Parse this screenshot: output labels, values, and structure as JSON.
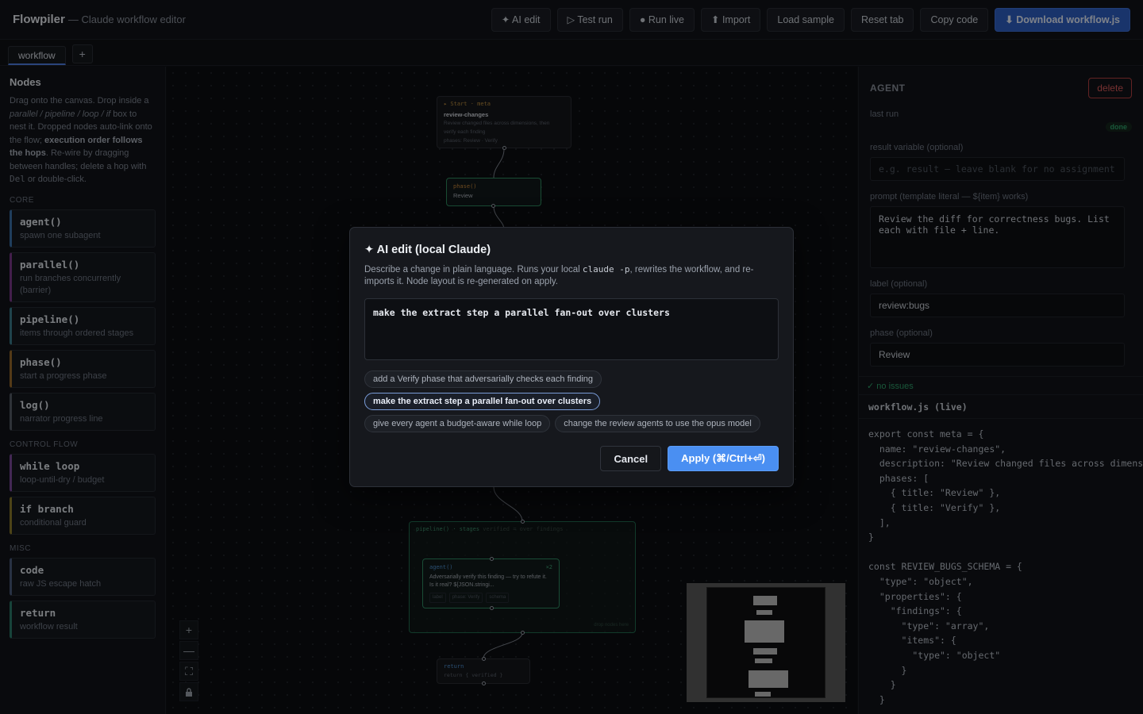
{
  "header": {
    "brand": "Flowpiler",
    "subtitle": "— Claude workflow editor",
    "buttons": {
      "ai_edit": "✦ AI edit",
      "test_run": "▷ Test run",
      "run_live": "● Run live",
      "import": "⬆ Import",
      "load_sample": "Load sample",
      "reset_tab": "Reset tab",
      "copy_code": "Copy code",
      "download": "⬇ Download workflow.js"
    }
  },
  "tabs": {
    "items": [
      "workflow"
    ],
    "add": "+"
  },
  "sidebar": {
    "title": "Nodes",
    "help_1": "Drag onto the canvas. Drop inside a",
    "help_2": "parallel / pipeline / loop / if",
    "help_3": " box to nest it. Dropped nodes auto-link onto the flow; ",
    "help_4": "execution order follows the hops",
    "help_5": ". Re-wire by dragging between handles; delete a hop with ",
    "help_6": "Del",
    "help_7": " or double-click.",
    "sections": {
      "core": "CORE",
      "control": "CONTROL FLOW",
      "misc": "MISC"
    },
    "core": [
      {
        "title": "agent()",
        "desc": "spawn one subagent"
      },
      {
        "title": "parallel()",
        "desc": "run branches concurrently (barrier)"
      },
      {
        "title": "pipeline()",
        "desc": "items through ordered stages"
      },
      {
        "title": "phase()",
        "desc": "start a progress phase"
      },
      {
        "title": "log()",
        "desc": "narrator progress line"
      }
    ],
    "control": [
      {
        "title": "while loop",
        "desc": "loop-until-dry / budget"
      },
      {
        "title": "if branch",
        "desc": "conditional guard"
      }
    ],
    "misc": [
      {
        "title": "code",
        "desc": "raw JS escape hatch"
      },
      {
        "title": "return",
        "desc": "workflow result"
      }
    ]
  },
  "canvas": {
    "start": {
      "header": "▸ Start · meta",
      "name": "review-changes",
      "desc_1": "Review changed files across dimensions, then",
      "desc_2": "verify each finding",
      "phases": "phases: Review · Verify"
    },
    "phase": {
      "header": "phase()",
      "name": "Review"
    },
    "pipeline": {
      "header": "pipeline() · stages",
      "header_dim": "verified = over findings",
      "drop": "drop nodes here"
    },
    "agent": {
      "header": "agent()",
      "count": "×2",
      "body": "Adversarially verify this finding — try to refute it. Is it real? ${JSON.stringi...",
      "tags": [
        "label",
        "phase: Verify",
        "schema"
      ]
    },
    "return": {
      "header": "return",
      "body": "return { verified }"
    },
    "controls": {
      "zoom_in": "+",
      "zoom_out": "—",
      "fit": "⛶",
      "lock": "🔒"
    }
  },
  "inspector": {
    "kind": "AGENT",
    "delete": "delete",
    "last_run_label": "last run",
    "last_run_status": "done",
    "result_label": "result variable (optional)",
    "result_placeholder": "e.g. result — leave blank for no assignment",
    "prompt_label": "prompt (template literal — ${item} works)",
    "prompt_value": "Review the diff for correctness bugs. List each with file + line.",
    "label_label": "label (optional)",
    "label_value": "review:bugs",
    "phase_label": "phase (optional)",
    "phase_value": "Review",
    "status": "✓ no issues",
    "code_title": "workflow.js (live)",
    "code": "export const meta = {\n  name: \"review-changes\",\n  description: \"Review changed files across dimensions, then verify each finding\",\n  phases: [\n    { title: \"Review\" },\n    { title: \"Verify\" },\n  ],\n}\n\nconst REVIEW_BUGS_SCHEMA = {\n  \"type\": \"object\",\n  \"properties\": {\n    \"findings\": {\n      \"type\": \"array\",\n      \"items\": {\n        \"type\": \"object\"\n      }\n    }\n  }"
  },
  "modal": {
    "title": "✦ AI edit (local Claude)",
    "desc_1": "Describe a change in plain language. Runs your local ",
    "desc_code": "claude -p",
    "desc_2": ", rewrites the workflow, and re-imports it. Node layout is re-generated on apply.",
    "input_value": "make the extract step a parallel fan-out over clusters",
    "suggestions": [
      "add a Verify phase that adversarially checks each finding",
      "make the extract step a parallel fan-out over clusters",
      "give every agent a budget-aware while loop",
      "change the review agents to use the opus model"
    ],
    "selected_suggestion": 1,
    "cancel": "Cancel",
    "apply": "Apply (⌘/Ctrl+⏎)"
  }
}
